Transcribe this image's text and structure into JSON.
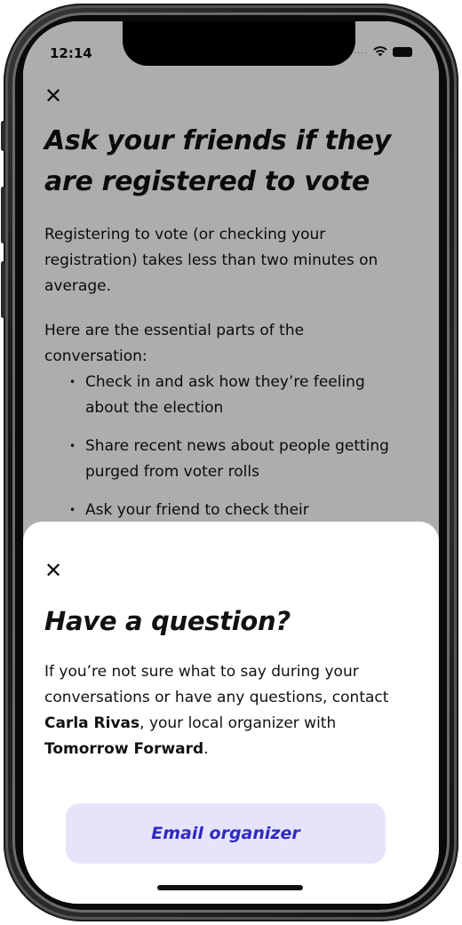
{
  "status_bar": {
    "time": "12:14",
    "signal_dots": "....",
    "wifi_icon": "wifi-icon",
    "battery_icon": "battery-icon"
  },
  "background_screen": {
    "close_icon": "close-icon",
    "title": "Ask your friends if they are registered to vote",
    "paragraph_1": "Registering to vote (or checking your registration) takes less than two minutes on average.",
    "paragraph_2": "Here are the essential parts of the conversation:",
    "bullets": [
      "Check in and ask how they’re feeling about the election",
      "Share recent news about people getting purged from voter rolls",
      "Ask your friend to check their"
    ]
  },
  "sheet": {
    "close_icon": "close-icon",
    "title": "Have a question?",
    "body_before": "If you’re not sure what to say during your conversations or have any questions, contact ",
    "organizer_name": "Carla Rivas",
    "body_middle": ", your local organizer with ",
    "organization": "Tomorrow Forward",
    "body_end": ".",
    "button_label": "Email organizer"
  },
  "colors": {
    "accent": "#2e2ac4",
    "button_bg": "#e6e4fb",
    "scrim": "rgba(0,0,0,0.32)"
  }
}
